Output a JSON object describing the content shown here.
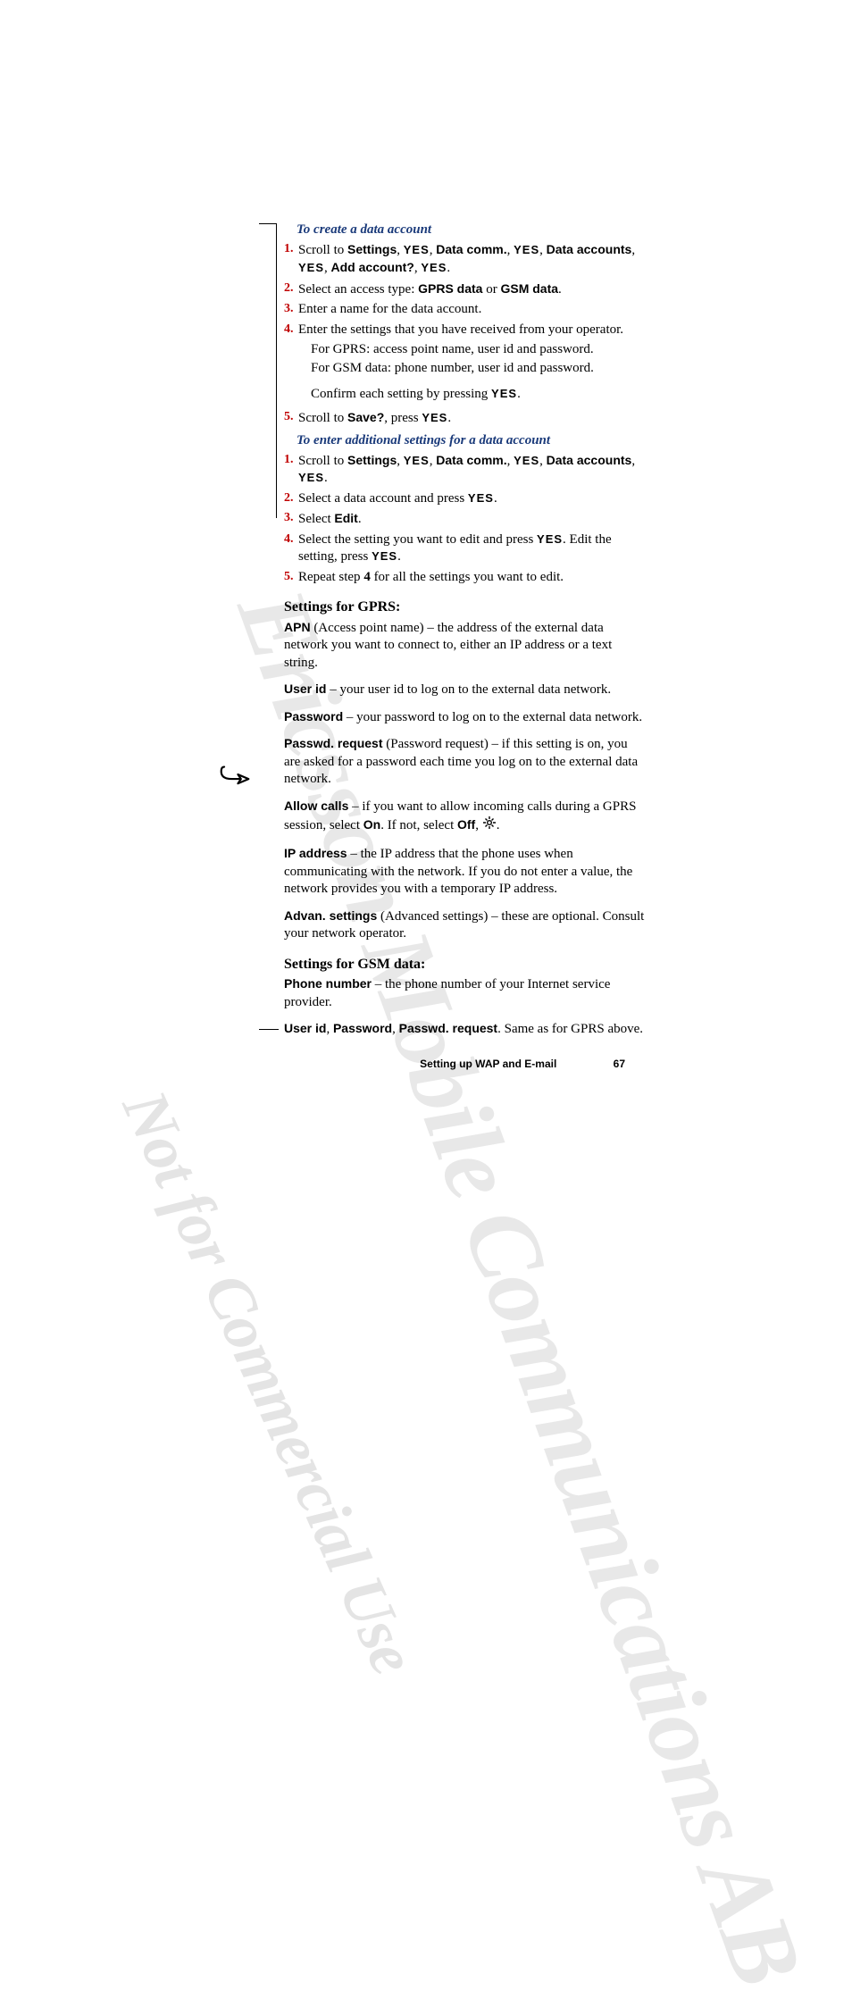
{
  "watermarks": {
    "large": "Ericsson Mobile Communications AB",
    "small": "Not for Commercial Use"
  },
  "procedures": {
    "create": {
      "heading": "To create a data account",
      "steps": [
        {
          "n": "1.",
          "pre": "Scroll to ",
          "b1": "Settings",
          "sep1": ", ",
          "y1": "YES",
          "sep2": ", ",
          "b2": "Data comm.",
          "sep3": ", ",
          "y2": "YES",
          "sep4": ", ",
          "b3": "Data accounts",
          "sep5": ", ",
          "y3": "YES",
          "sep6": ", ",
          "b4": "Add account?",
          "sep7": ", ",
          "y4": "YES",
          "post": "."
        },
        {
          "n": "2.",
          "pre": "Select an access type: ",
          "b1": "GPRS data",
          "mid": " or ",
          "b2": "GSM data",
          "post": "."
        },
        {
          "n": "3.",
          "text": "Enter a name for the data account."
        },
        {
          "n": "4.",
          "text": "Enter the settings that you have received from your operator."
        },
        {
          "n": "5.",
          "pre": "Scroll to ",
          "b1": "Save?",
          "mid": ", press ",
          "y1": "YES",
          "post": "."
        }
      ],
      "gprs_detail": "For GPRS: access point name, user id and password.",
      "gsm_detail": "For GSM data: phone number, user id and password.",
      "confirm_pre": "Confirm each setting by pressing ",
      "confirm_yes": "YES",
      "confirm_post": "."
    },
    "additional": {
      "heading": "To enter additional settings for a data account",
      "steps": [
        {
          "n": "1.",
          "pre": "Scroll to ",
          "b1": "Settings",
          "sep1": ", ",
          "y1": "YES",
          "sep2": ", ",
          "b2": "Data comm.",
          "sep3": ", ",
          "y2": "YES",
          "sep4": ", ",
          "b3": "Data accounts",
          "sep5": ", ",
          "y3": "YES",
          "post": "."
        },
        {
          "n": "2.",
          "pre": "Select a data account and press ",
          "y1": "YES",
          "post": "."
        },
        {
          "n": "3.",
          "pre": "Select ",
          "b1": "Edit",
          "post": "."
        },
        {
          "n": "4.",
          "pre": "Select the setting you want to edit and press ",
          "y1": "YES",
          "mid": ". Edit the setting, press ",
          "y2": "YES",
          "post": "."
        },
        {
          "n": "5.",
          "pre": "Repeat step ",
          "b1": "4",
          "post": " for all the settings you want to edit."
        }
      ]
    }
  },
  "gprs_section": {
    "heading": "Settings for GPRS:",
    "apn": {
      "label": "APN",
      "text": " (Access point name) – the address of the external data network you want to connect to, either an IP address or a text string."
    },
    "userid": {
      "label": "User id",
      "text": " – your user id to log on to the external data network."
    },
    "password": {
      "label": "Password",
      "text": " – your password to log on to the external data network."
    },
    "passwdreq": {
      "label": "Passwd. request",
      "text": " (Password request) – if this setting is on, you are asked for a password each time you log on to the external data network."
    },
    "allowcalls": {
      "label": "Allow calls",
      "pre": " – if you want to allow incoming calls during a GPRS session, select ",
      "on": "On",
      "mid": ". If not, select ",
      "off": "Off",
      "post": ", "
    },
    "ipaddress": {
      "label": "IP address",
      "text": " – the IP address that the phone uses when communicating with the network. If you do not enter a value, the network provides you with a temporary IP address."
    },
    "advan": {
      "label": "Advan. settings",
      "text": " (Advanced settings) – these are optional. Consult your network operator."
    }
  },
  "gsm_section": {
    "heading": "Settings for GSM data:",
    "phone": {
      "label": "Phone number",
      "text": " – the phone number of your Internet service provider."
    },
    "same": {
      "b1": "User id",
      "s1": ", ",
      "b2": "Password",
      "s2": ", ",
      "b3": "Passwd. request",
      "post": ". Same as for GPRS above."
    }
  },
  "footer": {
    "title": "Setting up WAP and E-mail",
    "page": "67"
  }
}
